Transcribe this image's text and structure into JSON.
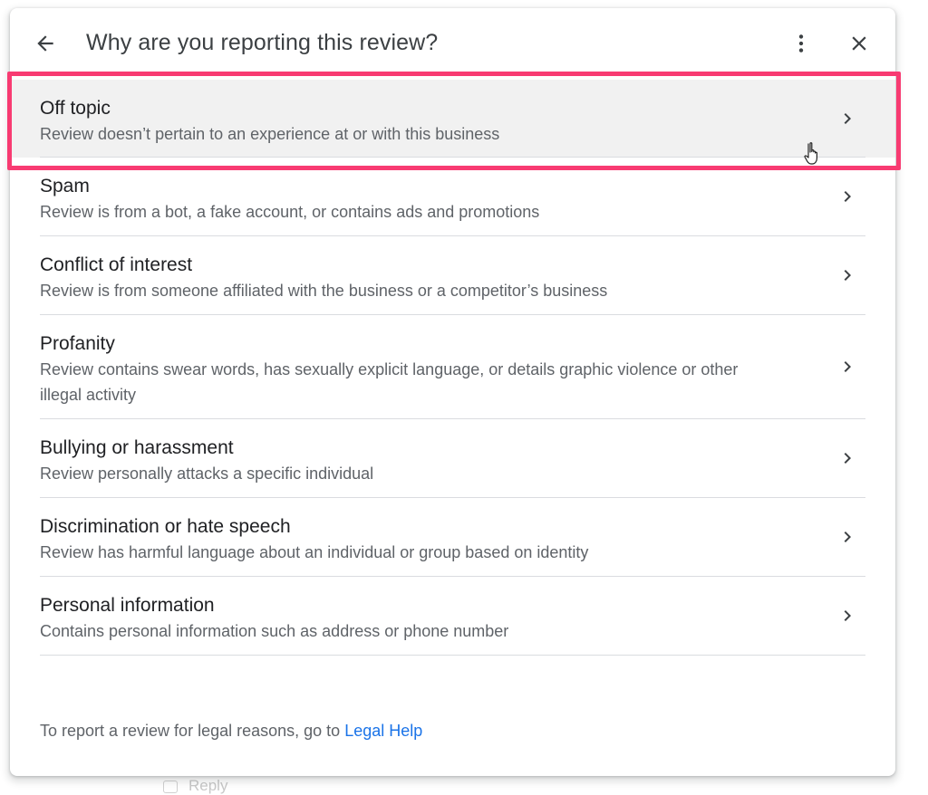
{
  "dialog": {
    "title": "Why are you reporting this review?",
    "back_icon": "arrow-back-icon",
    "more_icon": "more-vert-icon",
    "close_icon": "close-icon"
  },
  "options": [
    {
      "title": "Off topic",
      "description": "Review doesn’t pertain to an experience at or with this business"
    },
    {
      "title": "Spam",
      "description": "Review is from a bot, a fake account, or contains ads and promotions"
    },
    {
      "title": "Conflict of interest",
      "description": "Review is from someone affiliated with the business or a competitor’s business"
    },
    {
      "title": "Profanity",
      "description": "Review contains swear words, has sexually explicit language, or details graphic violence or other illegal activity"
    },
    {
      "title": "Bullying or harassment",
      "description": "Review personally attacks a specific individual"
    },
    {
      "title": "Discrimination or hate speech",
      "description": "Review has harmful language about an individual or group based on identity"
    },
    {
      "title": "Personal information",
      "description": "Contains personal information such as address or phone number"
    }
  ],
  "footer": {
    "text": "To report a review for legal reasons, go to ",
    "link_label": "Legal Help"
  },
  "background": {
    "reply_label": "Reply"
  },
  "colors": {
    "highlight_border": "#f83b72",
    "link": "#1a73e8"
  }
}
